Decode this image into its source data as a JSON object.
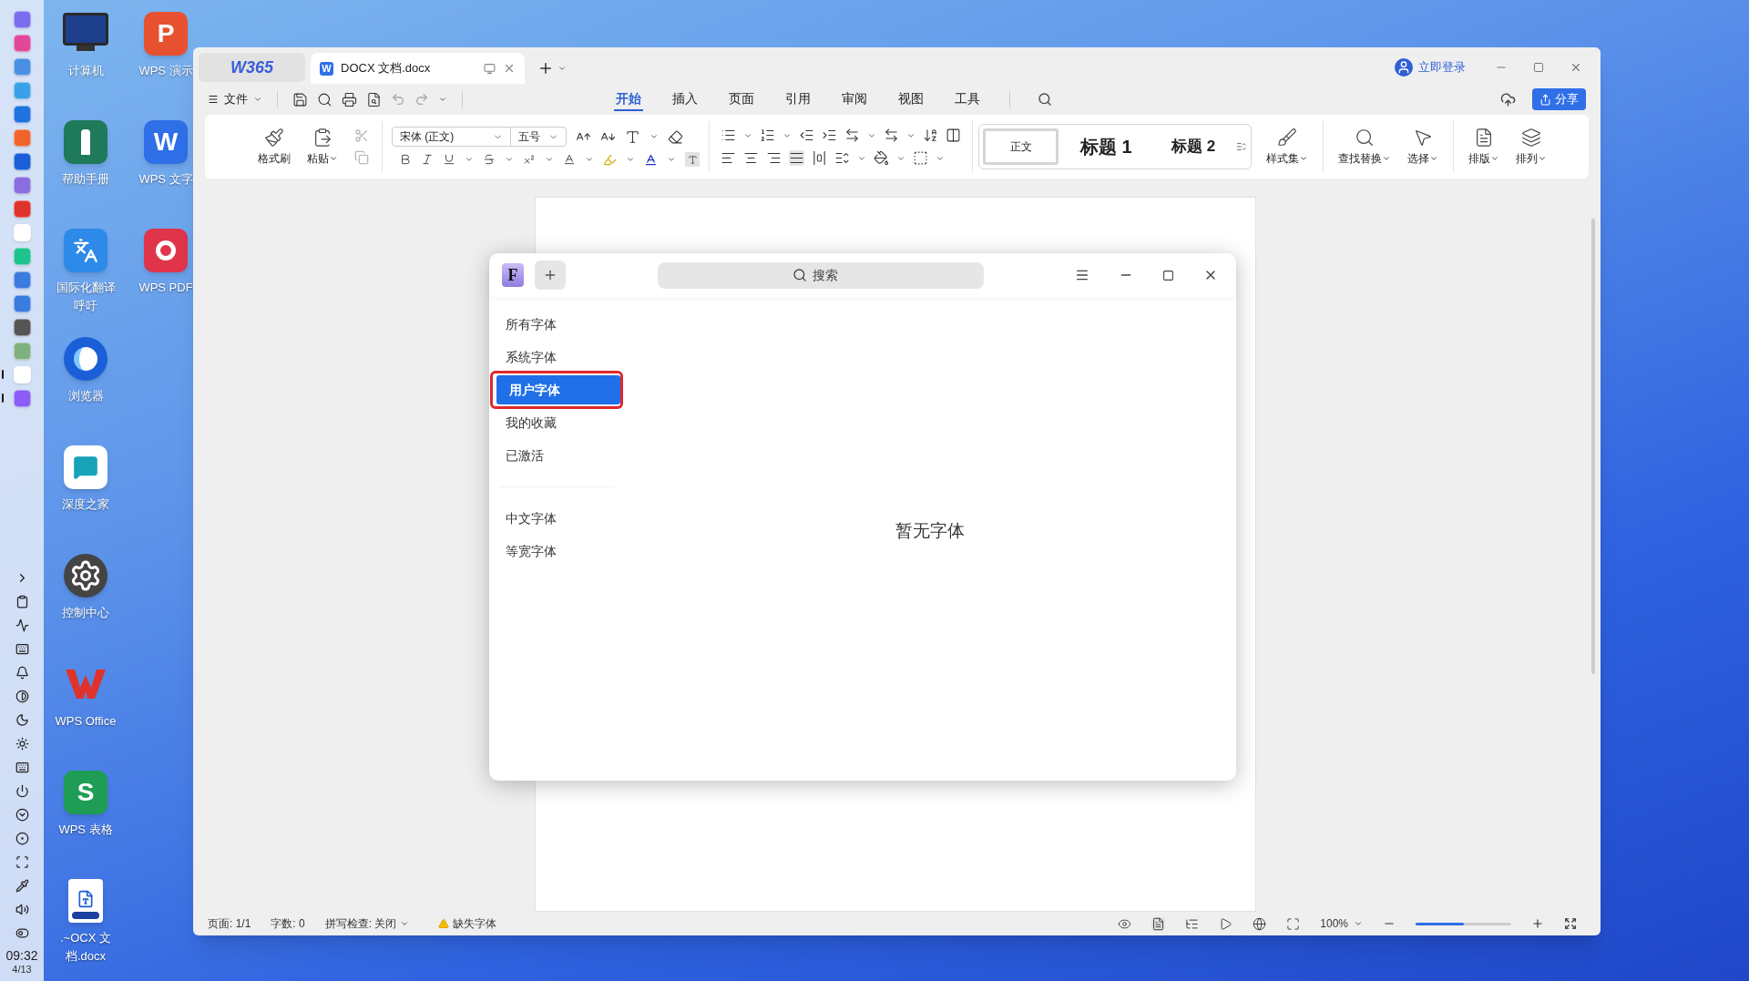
{
  "dock": {
    "apps": [
      {
        "running": false
      },
      {
        "running": false
      },
      {
        "running": false
      },
      {
        "running": false
      },
      {
        "running": false
      },
      {
        "running": false
      },
      {
        "running": false
      },
      {
        "running": false
      },
      {
        "running": false
      },
      {
        "running": false
      },
      {
        "running": false
      },
      {
        "running": false
      },
      {
        "running": false
      },
      {
        "running": false
      },
      {
        "running": false
      },
      {
        "running": true
      },
      {
        "running": true
      }
    ],
    "time": "09:32",
    "date": "4/13"
  },
  "desktop_icons": [
    {
      "label": "计算机",
      "kind": "monitor"
    },
    {
      "label": "帮助手册",
      "kind": "lighthouse"
    },
    {
      "label": "国际化翻译呼吁",
      "kind": "translate"
    },
    {
      "label": "浏览器",
      "kind": "browser"
    },
    {
      "label": "深度之家",
      "kind": "chat"
    },
    {
      "label": "控制中心",
      "kind": "gear"
    },
    {
      "label": "WPS Office",
      "kind": "wps"
    },
    {
      "label": "WPS 表格",
      "kind": "letter",
      "letter": "S",
      "color": "#1f9d55"
    },
    {
      "label": ".~OCX 文档.docx",
      "kind": "file"
    },
    {
      "label": "WPS 演示",
      "kind": "letter",
      "letter": "P",
      "color": "#e8512f"
    },
    {
      "label": "WPS 文字",
      "kind": "letter",
      "letter": "W",
      "color": "#2f6fe8"
    },
    {
      "label": "WPS PDF",
      "kind": "pdf"
    }
  ],
  "window": {
    "home_tab": "W365",
    "doc_tab": {
      "icon_letter": "W",
      "title": "DOCX 文档.docx",
      "selected": true
    },
    "login": "立即登录"
  },
  "menu": {
    "file": "文件",
    "tabs": [
      {
        "label": "开始",
        "selected": true
      },
      {
        "label": "插入",
        "selected": false
      },
      {
        "label": "页面",
        "selected": false
      },
      {
        "label": "引用",
        "selected": false
      },
      {
        "label": "审阅",
        "selected": false
      },
      {
        "label": "视图",
        "selected": false
      },
      {
        "label": "工具",
        "selected": false
      }
    ],
    "share": "分享"
  },
  "ribbon": {
    "format_painter": "格式刷",
    "paste": "粘贴",
    "font": "宋体 (正文)",
    "size": "五号",
    "styles": [
      {
        "label": "正文",
        "selected": true
      },
      {
        "label": "标题 1",
        "selected": false
      },
      {
        "label": "标题 2",
        "selected": false
      }
    ],
    "style_set": "样式集",
    "find_replace": "查找替换",
    "select": "选择",
    "layout": "排版",
    "arrange": "排列"
  },
  "dialog": {
    "logo_letter": "F",
    "search_placeholder": "搜索",
    "categories": [
      {
        "label": "所有字体",
        "selected": false,
        "highlighted": false
      },
      {
        "label": "系统字体",
        "selected": false,
        "highlighted": false
      },
      {
        "label": "用户字体",
        "selected": true,
        "highlighted": true
      },
      {
        "label": "我的收藏",
        "selected": false,
        "highlighted": false
      },
      {
        "label": "已激活",
        "selected": false,
        "highlighted": false
      }
    ],
    "groups": [
      {
        "label": "中文字体",
        "selected": false
      },
      {
        "label": "等宽字体",
        "selected": false
      }
    ],
    "empty": "暂无字体"
  },
  "status_bar": {
    "page": "页面: 1/1",
    "words": "字数: 0",
    "spell": "拼写检查: 关闭",
    "missing_fonts": "缺失字体",
    "zoom": "100%",
    "zoom_slider": {
      "level": 0.5
    }
  }
}
